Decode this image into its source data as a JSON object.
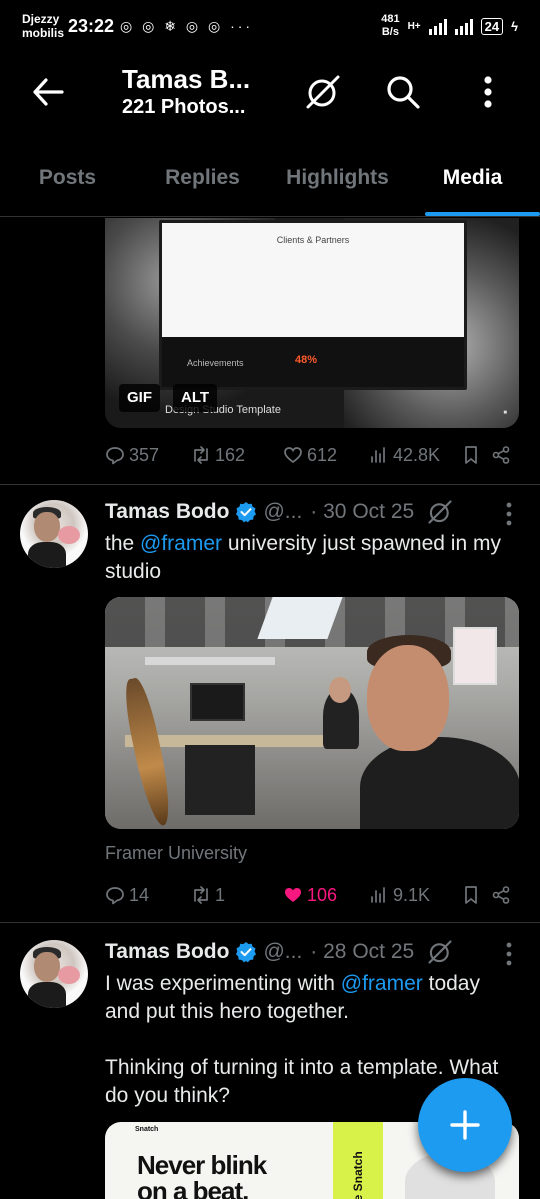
{
  "status_bar": {
    "carrier_line1": "Djezzy",
    "carrier_line2": "mobilis",
    "time": "23:22",
    "notif_icons": "◎ ◎ ❄ ◎ ◎ ···",
    "netspeed_value": "481",
    "netspeed_unit": "B/s",
    "network": "H+",
    "battery": "24"
  },
  "header": {
    "profile_name": "Tamas B...",
    "subtitle": "221 Photos..."
  },
  "tabs": [
    {
      "label": "Posts"
    },
    {
      "label": "Replies"
    },
    {
      "label": "Highlights"
    },
    {
      "label": "Media",
      "active": true
    }
  ],
  "post0": {
    "media": {
      "card_title": "Clients & Partners",
      "achievements": "Achievements",
      "percent": "48%",
      "caption": "Design Studio Template",
      "badges": [
        "GIF",
        "ALT"
      ]
    },
    "stats": {
      "replies": "357",
      "reposts": "162",
      "likes": "612",
      "views": "42.8K"
    }
  },
  "post1": {
    "name": "Tamas Bodo",
    "handle": "@...",
    "date": "· 30 Oct 25",
    "text_before": "the ",
    "mention": "@framer",
    "text_after": " university just spawned in my studio",
    "photo_caption": "Framer University",
    "stats": {
      "replies": "14",
      "reposts": "1",
      "likes": "106",
      "views": "9.1K"
    },
    "liked": true
  },
  "post2": {
    "name": "Tamas Bodo",
    "handle": "@...",
    "date": "· 28 Oct 25",
    "text_before": "I was experimenting with ",
    "mention": "@framer",
    "text_after": " today and put this hero together.\n\nThinking of turning it into a template. What do you think?",
    "media": {
      "logo": "Snatch",
      "headline_line1": "Never blink",
      "headline_line2": "on a beat.",
      "card_text": "me Snatch"
    }
  },
  "colors": {
    "accent": "#1d9bf0",
    "like": "#f91880",
    "muted": "#71767b",
    "background": "#000000"
  }
}
